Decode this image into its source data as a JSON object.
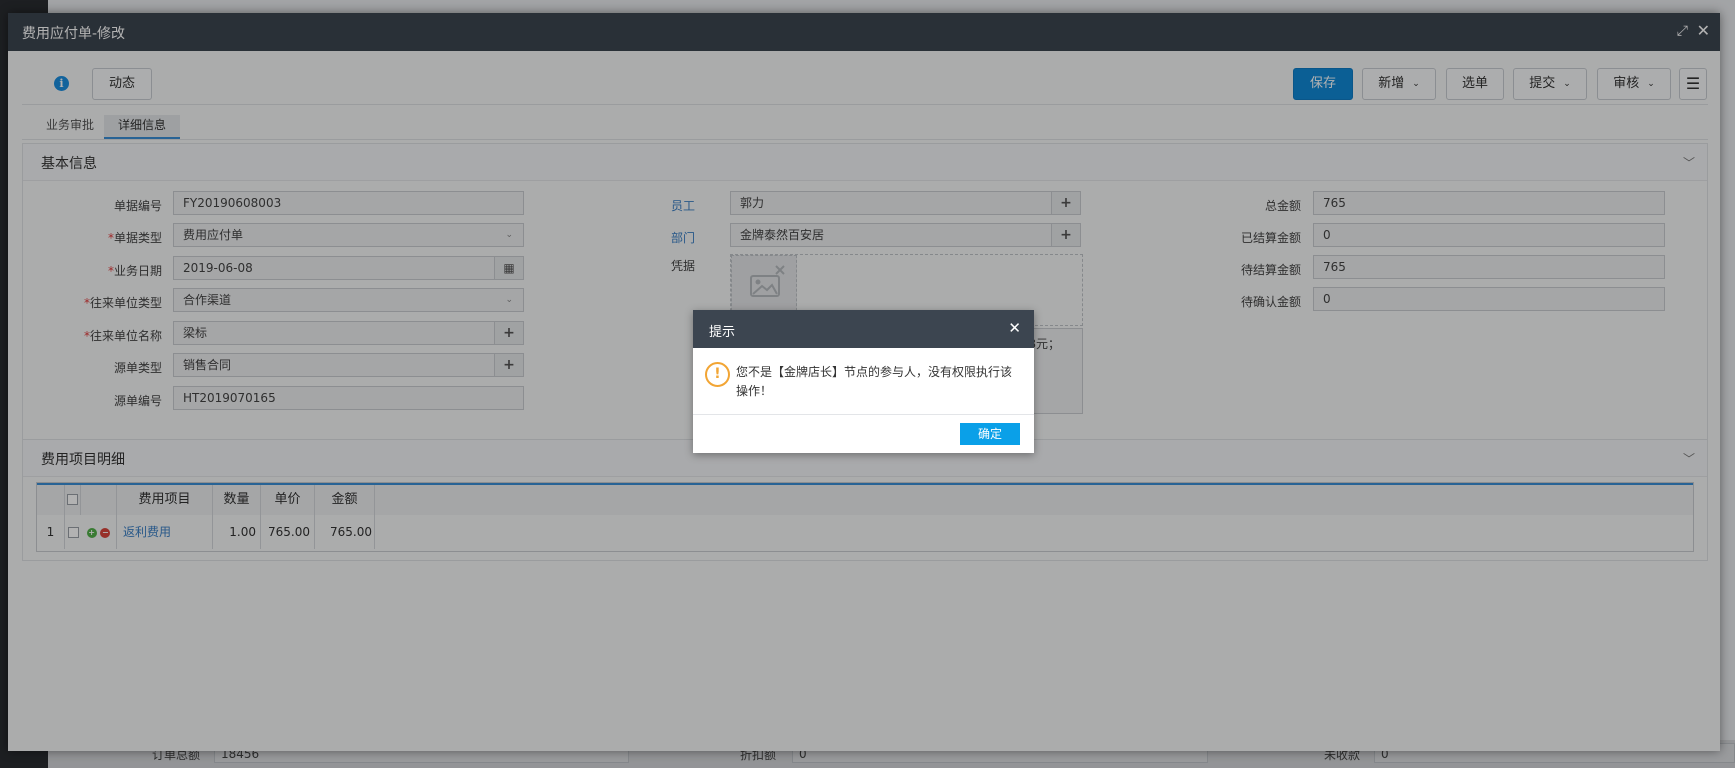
{
  "background": {
    "bottom_row": {
      "label1": "订单总额",
      "value1": "18456",
      "label2": "折扣额",
      "value2": "0",
      "label3": "未收款",
      "value3": "0"
    }
  },
  "window": {
    "title": "费用应付单-修改",
    "maximize_icon": "expand-icon",
    "close_icon": "close-icon"
  },
  "toolbar": {
    "dynamic_label": "动态",
    "save_label": "保存",
    "new_label": "新增",
    "select_label": "选单",
    "submit_label": "提交",
    "audit_label": "审核"
  },
  "tabs": [
    {
      "label": "业务审批",
      "active": false
    },
    {
      "label": "详细信息",
      "active": true
    }
  ],
  "basic_info": {
    "title": "基本信息",
    "doc_no_label": "单据编号",
    "doc_no": "FY20190608003",
    "doc_type_label": "单据类型",
    "doc_type": "费用应付单",
    "biz_date_label": "业务日期",
    "biz_date": "2019-06-08",
    "partner_type_label": "往来单位类型",
    "partner_type": "合作渠道",
    "partner_name_label": "往来单位名称",
    "partner_name": "梁标",
    "source_type_label": "源单类型",
    "source_type": "销售合同",
    "source_no_label": "源单编号",
    "source_no": "HT2019070165",
    "employee_label": "员工",
    "employee": "郭力",
    "dept_label": "部门",
    "dept": "金牌泰然百安居",
    "voucher_label": "凭据",
    "remark_tail": "8元；",
    "total_label": "总金额",
    "total": "765",
    "settled_label": "已结算金额",
    "settled": "0",
    "pending_settle_label": "待结算金额",
    "pending_settle": "765",
    "pending_confirm_label": "待确认金额",
    "pending_confirm": "0"
  },
  "cost_detail": {
    "title": "费用项目明细",
    "columns": [
      "费用项目",
      "数量",
      "单价",
      "金额"
    ],
    "rows": [
      {
        "index": "1",
        "item": "返利费用",
        "qty": "1.00",
        "price": "765.00",
        "amount": "765.00"
      }
    ]
  },
  "dialog": {
    "title": "提示",
    "message": "您不是【金牌店长】节点的参与人，没有权限执行该操作！",
    "ok_label": "确定"
  },
  "colors": {
    "primary": "#1188d6",
    "title_bar": "#3c4550",
    "warning": "#f2a534",
    "ok_button": "#0aa0e8",
    "link": "#3a7fc4",
    "required": "#e23b3b"
  }
}
